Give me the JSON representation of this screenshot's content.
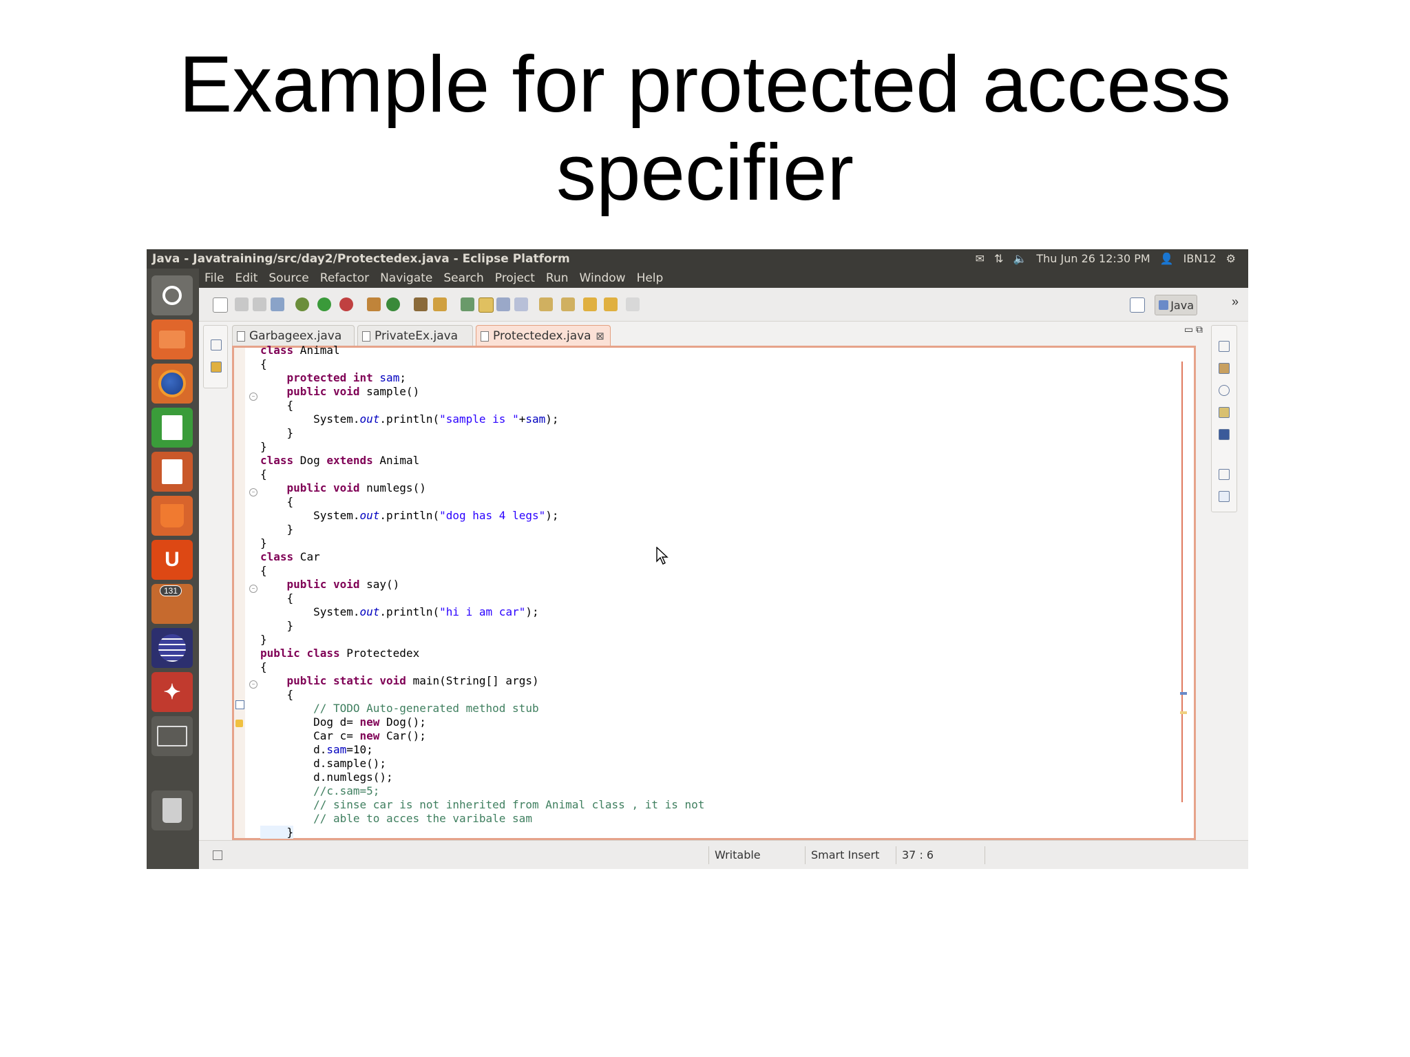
{
  "slide": {
    "title_line1": "Example for protected access",
    "title_line2": "specifier"
  },
  "window": {
    "title": "Java - Javatraining/src/day2/Protectedex.java - Eclipse Platform"
  },
  "tray": {
    "datetime": "Thu Jun 26 12:30 PM",
    "user": "IBN12"
  },
  "menu": [
    "File",
    "Edit",
    "Source",
    "Refactor",
    "Navigate",
    "Search",
    "Project",
    "Run",
    "Window",
    "Help"
  ],
  "launcher": {
    "badge_count": "131"
  },
  "toolbar": {
    "perspective_label": "Java"
  },
  "tabs": [
    {
      "label": "Garbageex.java",
      "active": false
    },
    {
      "label": "PrivateEx.java",
      "active": false
    },
    {
      "label": "Protectedex.java",
      "active": true
    }
  ],
  "code_lines": [
    "class Animal",
    "{",
    "    protected int sam;",
    "    public void sample()",
    "    {",
    "        System.out.println(\"sample is \"+sam);",
    "    }",
    "}",
    "class Dog extends Animal",
    "{",
    "    public void numlegs()",
    "    {",
    "        System.out.println(\"dog has 4 legs\");",
    "    }",
    "}",
    "class Car",
    "{",
    "    public void say()",
    "    {",
    "        System.out.println(\"hi i am car\");",
    "    }",
    "}",
    "public class Protectedex",
    "{",
    "    public static void main(String[] args)",
    "    {",
    "        // TODO Auto-generated method stub",
    "        Dog d= new Dog();",
    "        Car c= new Car();",
    "        d.sam=10;",
    "        d.sample();",
    "        d.numlegs();",
    "        //c.sam=5;",
    "        // sinse car is not inherited from Animal class , it is not",
    "        // able to acces the varibale sam",
    "    }"
  ],
  "status": {
    "writable": "Writable",
    "insert_mode": "Smart Insert",
    "position": "37 : 6"
  }
}
